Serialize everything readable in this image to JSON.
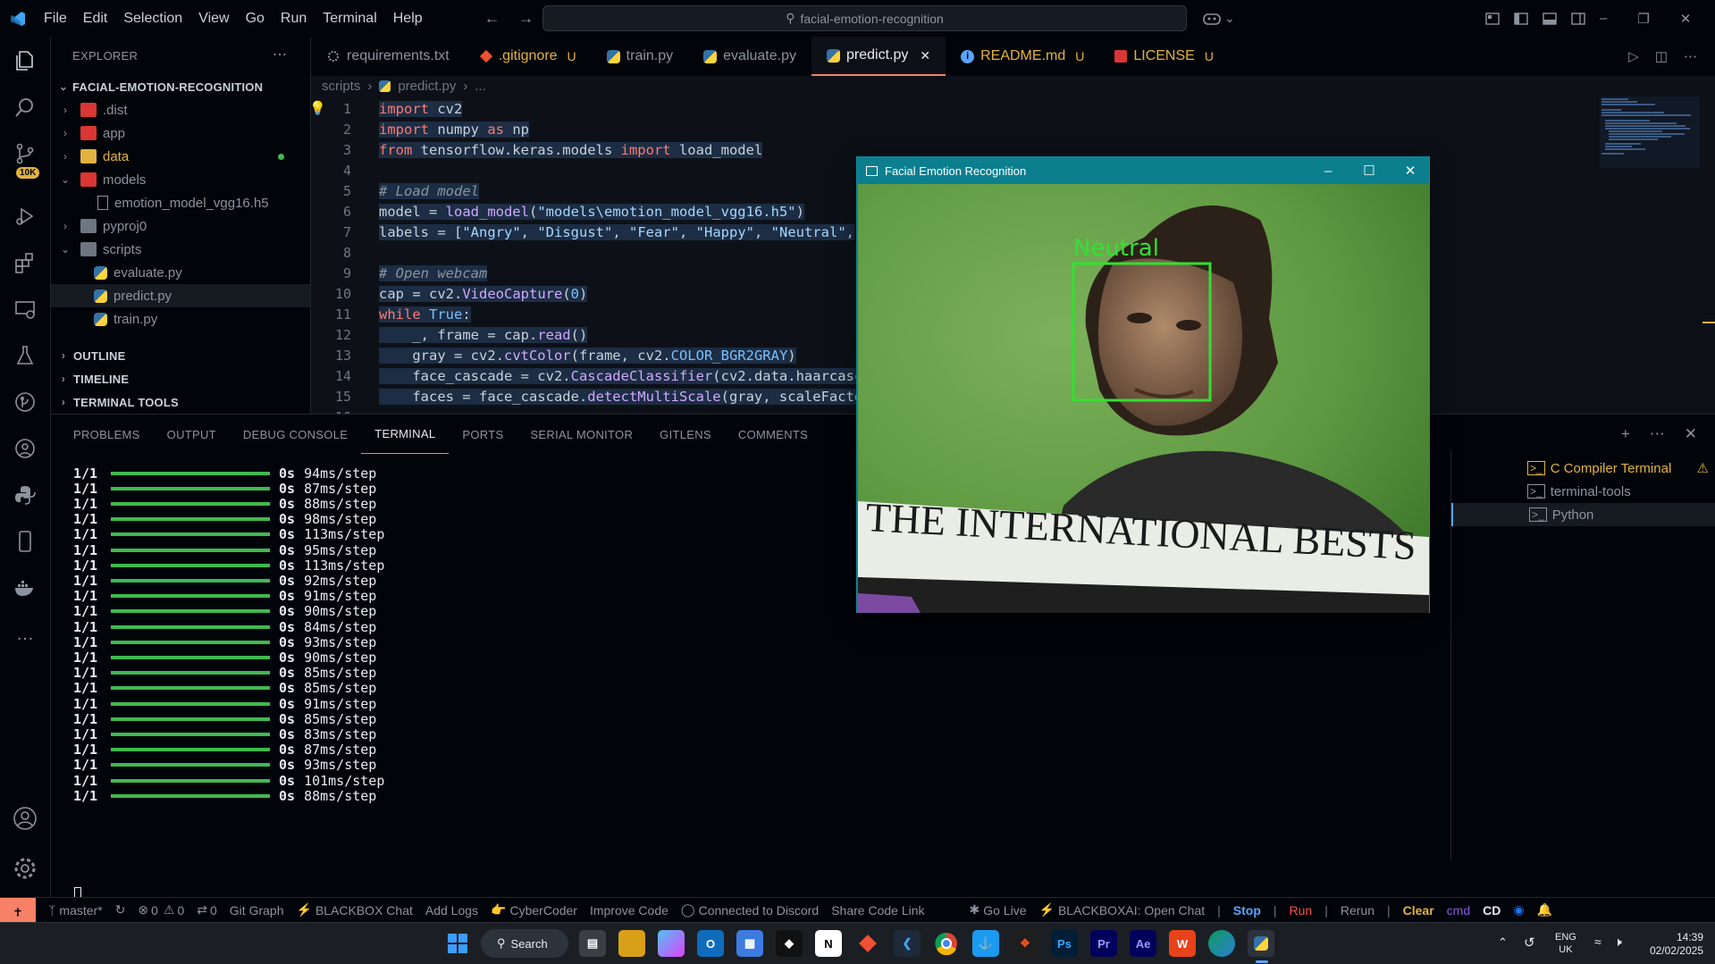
{
  "titlebar": {
    "menu": [
      "File",
      "Edit",
      "Selection",
      "View",
      "Go",
      "Run",
      "Terminal",
      "Help"
    ],
    "search": "facial-emotion-recognition"
  },
  "activity": {
    "badge": "10K"
  },
  "explorer": {
    "title": "EXPLORER",
    "root": "FACIAL-EMOTION-RECOGNITION",
    "items": [
      {
        "label": ".dist",
        "kind": "folder",
        "open": false,
        "depth": 1
      },
      {
        "label": "app",
        "kind": "folder",
        "open": false,
        "depth": 1
      },
      {
        "label": "data",
        "kind": "folder",
        "open": false,
        "depth": 1
      },
      {
        "label": "models",
        "kind": "folder",
        "open": true,
        "depth": 1
      },
      {
        "label": "emotion_model_vgg16.h5",
        "kind": "file",
        "depth": 2
      },
      {
        "label": "pyproj0",
        "kind": "folder",
        "open": false,
        "depth": 1
      },
      {
        "label": "scripts",
        "kind": "folder",
        "open": true,
        "depth": 1
      },
      {
        "label": "evaluate.py",
        "kind": "py",
        "depth": 2
      },
      {
        "label": "predict.py",
        "kind": "py",
        "depth": 2
      },
      {
        "label": "train.py",
        "kind": "py",
        "depth": 2
      }
    ],
    "sections": [
      "OUTLINE",
      "TIMELINE",
      "TERMINAL TOOLS"
    ]
  },
  "tabs": [
    {
      "label": "requirements.txt",
      "badge": "",
      "active": false
    },
    {
      "label": ".gitignore",
      "badge": "U",
      "active": false
    },
    {
      "label": "train.py",
      "badge": "",
      "active": false
    },
    {
      "label": "evaluate.py",
      "badge": "",
      "active": false
    },
    {
      "label": "predict.py",
      "badge": "",
      "active": true
    },
    {
      "label": "README.md",
      "badge": "U",
      "active": false
    },
    {
      "label": "LICENSE",
      "badge": "U",
      "active": false
    }
  ],
  "breadcrumb": [
    "scripts",
    "predict.py",
    "..."
  ],
  "code": [
    {
      "n": "1",
      "t": "import cv2"
    },
    {
      "n": "2",
      "t": "import numpy as np"
    },
    {
      "n": "3",
      "t": "from tensorflow.keras.models import load_model"
    },
    {
      "n": "4",
      "t": ""
    },
    {
      "n": "5",
      "t": "# Load model"
    },
    {
      "n": "6",
      "t": "model = load_model(\"models\\emotion_model_vgg16.h5\")"
    },
    {
      "n": "7",
      "t": "labels = [\"Angry\", \"Disgust\", \"Fear\", \"Happy\", \"Neutral\","
    },
    {
      "n": "8",
      "t": ""
    },
    {
      "n": "9",
      "t": "# Open webcam"
    },
    {
      "n": "10",
      "t": "cap = cv2.VideoCapture(0)"
    },
    {
      "n": "11",
      "t": "while True:"
    },
    {
      "n": "12",
      "t": "    _, frame = cap.read()"
    },
    {
      "n": "13",
      "t": "    gray = cv2.cvtColor(frame, cv2.COLOR_BGR2GRAY)"
    },
    {
      "n": "14",
      "t": "    face_cascade = cv2.CascadeClassifier(cv2.data.haarcasc"
    },
    {
      "n": "15",
      "t": "    faces = face_cascade.detectMultiScale(gray, scaleFacto"
    },
    {
      "n": "16",
      "t": ""
    }
  ],
  "panel": {
    "tabs": [
      "PROBLEMS",
      "OUTPUT",
      "DEBUG CONSOLE",
      "TERMINAL",
      "PORTS",
      "SERIAL MONITOR",
      "GITLENS",
      "COMMENTS"
    ],
    "active": "TERMINAL",
    "terminal_lines": [
      {
        "frac": "1/1",
        "sec": "0s",
        "step": "94ms/step"
      },
      {
        "frac": "1/1",
        "sec": "0s",
        "step": "87ms/step"
      },
      {
        "frac": "1/1",
        "sec": "0s",
        "step": "88ms/step"
      },
      {
        "frac": "1/1",
        "sec": "0s",
        "step": "98ms/step"
      },
      {
        "frac": "1/1",
        "sec": "0s",
        "step": "113ms/step"
      },
      {
        "frac": "1/1",
        "sec": "0s",
        "step": "95ms/step"
      },
      {
        "frac": "1/1",
        "sec": "0s",
        "step": "113ms/step"
      },
      {
        "frac": "1/1",
        "sec": "0s",
        "step": "92ms/step"
      },
      {
        "frac": "1/1",
        "sec": "0s",
        "step": "91ms/step"
      },
      {
        "frac": "1/1",
        "sec": "0s",
        "step": "90ms/step"
      },
      {
        "frac": "1/1",
        "sec": "0s",
        "step": "84ms/step"
      },
      {
        "frac": "1/1",
        "sec": "0s",
        "step": "93ms/step"
      },
      {
        "frac": "1/1",
        "sec": "0s",
        "step": "90ms/step"
      },
      {
        "frac": "1/1",
        "sec": "0s",
        "step": "85ms/step"
      },
      {
        "frac": "1/1",
        "sec": "0s",
        "step": "85ms/step"
      },
      {
        "frac": "1/1",
        "sec": "0s",
        "step": "91ms/step"
      },
      {
        "frac": "1/1",
        "sec": "0s",
        "step": "85ms/step"
      },
      {
        "frac": "1/1",
        "sec": "0s",
        "step": "83ms/step"
      },
      {
        "frac": "1/1",
        "sec": "0s",
        "step": "87ms/step"
      },
      {
        "frac": "1/1",
        "sec": "0s",
        "step": "93ms/step"
      },
      {
        "frac": "1/1",
        "sec": "0s",
        "step": "101ms/step"
      },
      {
        "frac": "1/1",
        "sec": "0s",
        "step": "88ms/step"
      }
    ],
    "terminals": [
      "C Compiler Terminal",
      "terminal-tools",
      "Python"
    ]
  },
  "cv_window": {
    "title": "Facial Emotion Recognition",
    "label": "Neutral",
    "banner": "THE INTERNATIONAL BESTS"
  },
  "statusbar": {
    "branch": "master*",
    "errors": "0",
    "warnings": "0",
    "ports": "0",
    "items": [
      "Git Graph",
      "BLACKBOX Chat",
      "Add Logs",
      "CyberCoder",
      "Improve Code",
      "Connected to Discord",
      "Share Code Link",
      "Go Live",
      "BLACKBOXAI: Open Chat"
    ],
    "right": [
      "Stop",
      "Run",
      "Rerun",
      "Clear",
      "cmd",
      "CD"
    ]
  },
  "taskbar": {
    "search": "Search",
    "lang": "ENG",
    "region": "UK",
    "time": "14:39",
    "date": "02/02/2025"
  }
}
